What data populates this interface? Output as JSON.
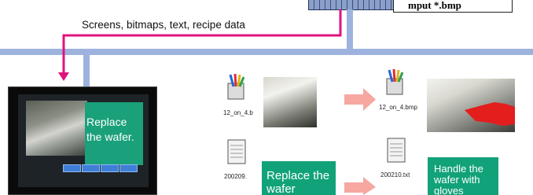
{
  "command_text": "mput *.bmp",
  "data_label": "Screens, bitmaps, text, recipe data",
  "hmi": {
    "message": "Replace the wafer.",
    "buttons": 4
  },
  "files_left": {
    "bitmap_name": "12_on_4.b",
    "text_name": "200209.",
    "text_content": "Replace the wafer"
  },
  "files_right": {
    "bitmap_name": "12_on_4.bmp",
    "text_name": "200210.txt",
    "text_content": "Handle the wafer with gloves"
  },
  "colors": {
    "bus": "#9db3dd",
    "flow_arrow": "#e0137d",
    "green_panel": "#12a27a",
    "update_arrow": "#f5a7a0"
  }
}
